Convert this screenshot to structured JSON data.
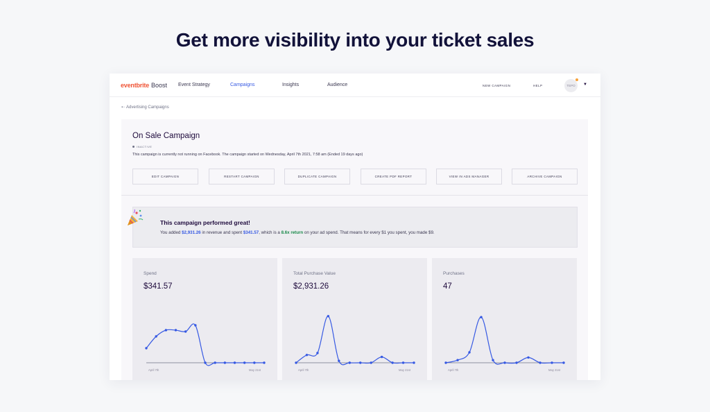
{
  "headline": "Get more visibility into your ticket sales",
  "topbar": {
    "brand": "eventbrite",
    "product": "Boost",
    "nav": [
      {
        "label": "Event Strategy",
        "active": false
      },
      {
        "label": "Campaigns",
        "active": true
      },
      {
        "label": "Insights",
        "active": false
      },
      {
        "label": "Audience",
        "active": false
      }
    ],
    "new_campaign": "NEW CAMPAIGN",
    "help": "HELP",
    "avatar_initials": "TEPO"
  },
  "back_link": "Advertising Campaigns",
  "campaign": {
    "title": "On Sale Campaign",
    "status": "INACTIVE",
    "description": "This campaign is currently not running on Facebook. The campaign started on Wednesday, April 7th 2021, 7:58 am (Ended 19 days ago)",
    "actions": [
      "EDIT CAMPAIGN",
      "RESTART CAMPAIGN",
      "DUPLICATE CAMPAIGN",
      "CREATE PDF REPORT",
      "VIEW IN ADS MANAGER",
      "ARCHIVE CAMPAIGN"
    ]
  },
  "banner": {
    "title": "This campaign performed great!",
    "text_1": "You added ",
    "revenue": "$2,931.26",
    "text_2": " in revenue and spent ",
    "spent": "$341.57",
    "text_3": ", which is a ",
    "return": "8.6x return",
    "text_4": " on your ad spend. That means for every $1 you spent, you made $9."
  },
  "colors": {
    "accent": "#3659e3",
    "brand": "#f05537",
    "positive": "#1a8a4a"
  },
  "cards": [
    {
      "label": "Spend",
      "value": "$341.57",
      "start_label": "April 7th",
      "end_label": "May 21st",
      "chart_data": {
        "type": "line",
        "values": [
          10.5,
          19,
          23.5,
          23.5,
          22.5,
          27,
          0,
          0,
          0,
          0,
          0,
          0,
          0
        ]
      }
    },
    {
      "label": "Total Purchase Value",
      "value": "$2,931.26",
      "start_label": "April 7th",
      "end_label": "May 21st",
      "chart_data": {
        "type": "line",
        "values": [
          0,
          5.6,
          7,
          33.6,
          1.4,
          0,
          0,
          0,
          4.2,
          0,
          0,
          0
        ]
      }
    },
    {
      "label": "Purchases",
      "value": "47",
      "start_label": "April 7th",
      "end_label": "May 21st",
      "chart_data": {
        "type": "line",
        "values": [
          0,
          1.9,
          7.5,
          32.9,
          1.9,
          0,
          0,
          3.8,
          0,
          0,
          0
        ]
      }
    }
  ]
}
